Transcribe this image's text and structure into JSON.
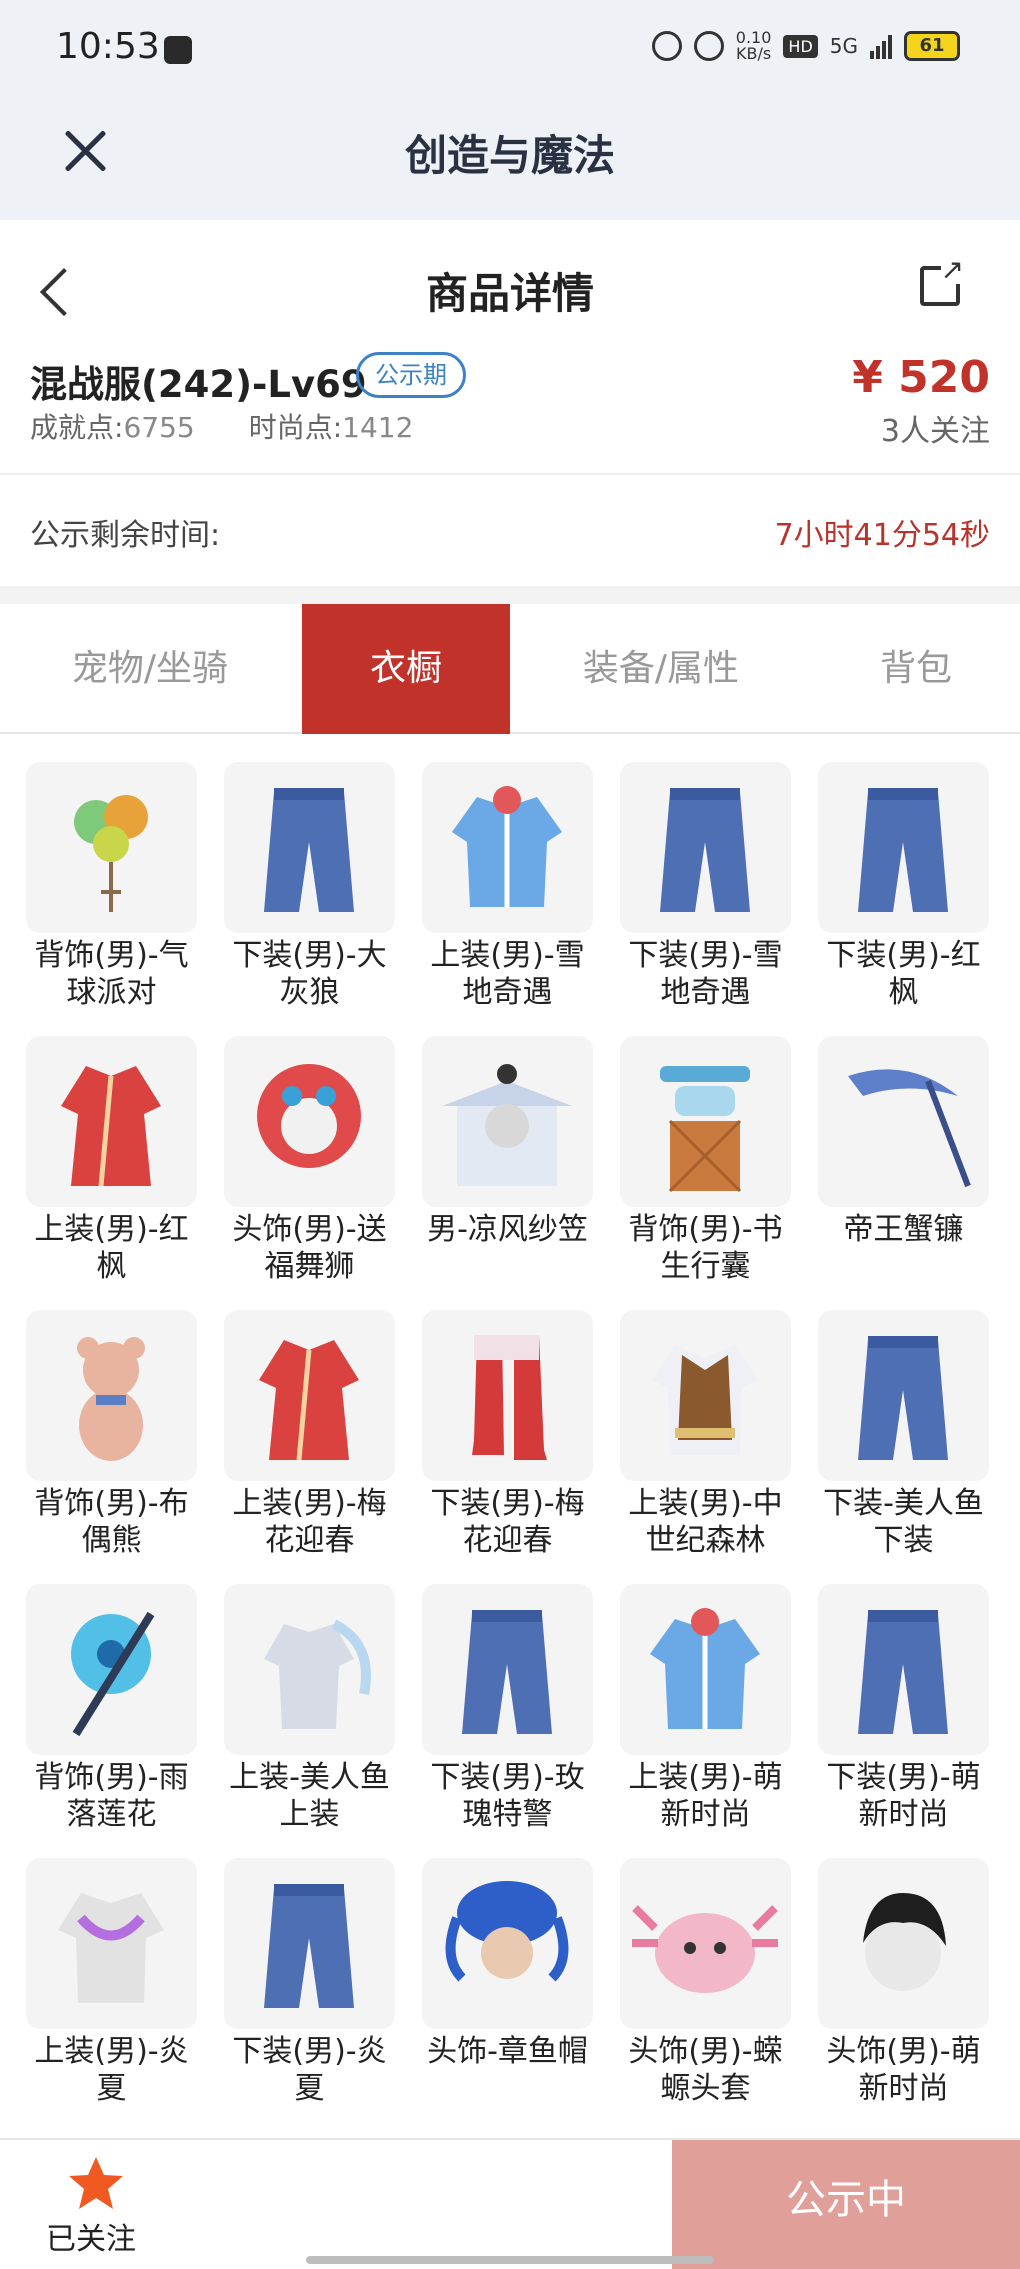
{
  "status_bar": {
    "time": "10:53",
    "net_speed_value": "0.10",
    "net_speed_unit": "KB/s",
    "hd": "HD",
    "network": "5G",
    "battery": "61"
  },
  "topbar": {
    "title": "创造与魔法"
  },
  "page": {
    "title": "商品详情"
  },
  "product": {
    "name": "混战服(242)-Lv69",
    "badge": "公示期",
    "achievement_label": "成就点:",
    "achievement_value": "6755",
    "fashion_label": "时尚点:",
    "fashion_value": "1412",
    "price": "¥ 520",
    "followers": "3人关注"
  },
  "countdown": {
    "label": "公示剩余时间:",
    "value": "7小时41分54秒"
  },
  "tabs": [
    {
      "label": "宠物/坐骑"
    },
    {
      "label": "衣橱"
    },
    {
      "label": "装备/属性"
    },
    {
      "label": "背包"
    }
  ],
  "active_tab": "衣橱",
  "items": [
    {
      "name": "背饰(男)-气球派对",
      "icon": "balloon-icon"
    },
    {
      "name": "下装(男)-大灰狼",
      "icon": "pants-icon"
    },
    {
      "name": "上装(男)-雪地奇遇",
      "icon": "jacket-icon"
    },
    {
      "name": "下装(男)-雪地奇遇",
      "icon": "pants-icon"
    },
    {
      "name": "下装(男)-红枫",
      "icon": "pants-icon"
    },
    {
      "name": "上装(男)-红枫",
      "icon": "robe-icon"
    },
    {
      "name": "头饰(男)-送福舞狮",
      "icon": "lion-head-icon"
    },
    {
      "name": "男-凉风纱笠",
      "icon": "hat-icon"
    },
    {
      "name": "背饰(男)-书生行囊",
      "icon": "backpack-icon"
    },
    {
      "name": "帝王蟹镰",
      "icon": "scythe-icon"
    },
    {
      "name": "背饰(男)-布偶熊",
      "icon": "teddy-bear-icon"
    },
    {
      "name": "上装(男)-梅花迎春",
      "icon": "robe-icon"
    },
    {
      "name": "下装(男)-梅花迎春",
      "icon": "boots-icon"
    },
    {
      "name": "上装(男)-中世纪森林",
      "icon": "vest-icon"
    },
    {
      "name": "下装-美人鱼下装",
      "icon": "pants-icon"
    },
    {
      "name": "背饰(男)-雨落莲花",
      "icon": "umbrella-icon"
    },
    {
      "name": "上装-美人鱼上装",
      "icon": "shirt-icon"
    },
    {
      "name": "下装(男)-玫瑰特警",
      "icon": "pants-icon"
    },
    {
      "name": "上装(男)-萌新时尚",
      "icon": "jacket-icon"
    },
    {
      "name": "下装(男)-萌新时尚",
      "icon": "pants-icon"
    },
    {
      "name": "上装(男)-炎夏",
      "icon": "torso-icon"
    },
    {
      "name": "下装(男)-炎夏",
      "icon": "pants-icon"
    },
    {
      "name": "头饰-章鱼帽",
      "icon": "octopus-hat-icon"
    },
    {
      "name": "头饰(男)-蝾螈头套",
      "icon": "axolotl-head-icon"
    },
    {
      "name": "头饰(男)-萌新时尚",
      "icon": "hair-icon"
    }
  ],
  "bottom": {
    "follow_label": "已关注",
    "status_button": "公示中"
  },
  "colors": {
    "accent": "#c1322b",
    "badge_blue": "#3e82c6",
    "status_button": "#e09f99",
    "star": "#f05a22"
  }
}
